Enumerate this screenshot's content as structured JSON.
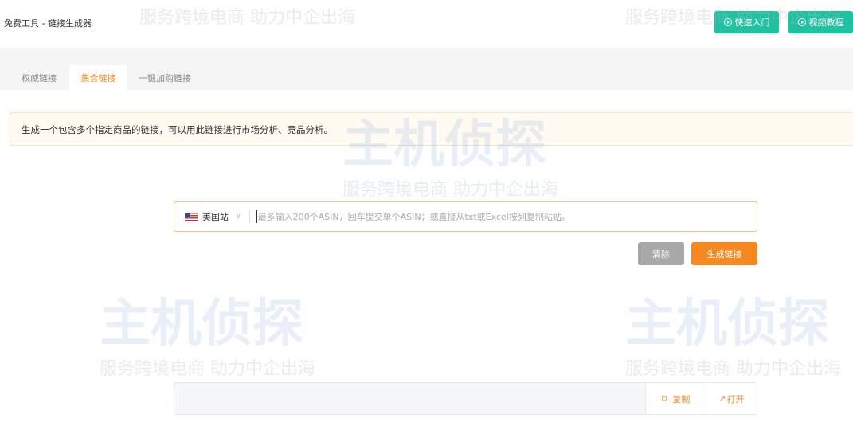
{
  "header": {
    "title": "免费工具 - 链接生成器",
    "buttons": [
      {
        "label": "快速入门",
        "icon": "play-circle-icon"
      },
      {
        "label": "视频教程",
        "icon": "play-circle-icon"
      }
    ]
  },
  "tabs": [
    {
      "label": "权威链接",
      "active": false
    },
    {
      "label": "集合链接",
      "active": true
    },
    {
      "label": "一键加购链接",
      "active": false
    }
  ],
  "notice": "生成一个包含多个指定商品的链接，可以用此链接进行市场分析、竞品分析。",
  "input": {
    "site": "美国站",
    "placeholder": "最多输入200个ASIN，回车提交单个ASIN；或直接从txt或Excel按列复制粘贴。"
  },
  "actions": {
    "clear": "清除",
    "generate": "生成链接"
  },
  "output": {
    "copy": "复制",
    "open": "打开"
  },
  "watermark": {
    "logo": "主机侦探",
    "slogan": "服务跨境电商 助力中企出海"
  },
  "colors": {
    "accent": "#f5891f",
    "teal": "#1fc1a0",
    "gray": "#a8a8a8"
  }
}
